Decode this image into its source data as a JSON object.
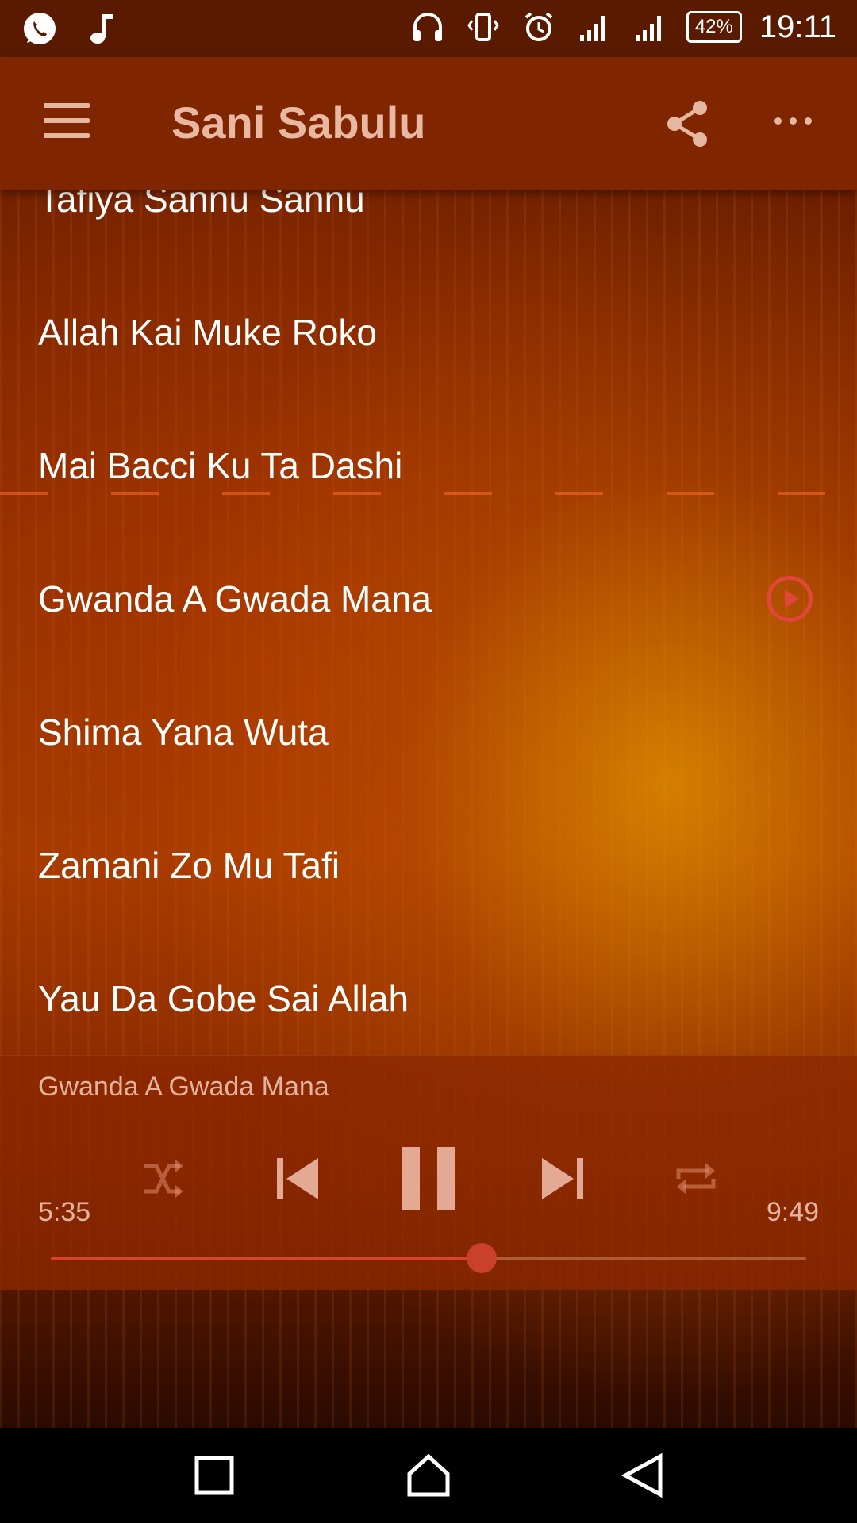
{
  "status_bar": {
    "time": "19:11",
    "battery": "42%",
    "left_icons": [
      "whatsapp-icon",
      "music-note-icon"
    ],
    "right_icons": [
      "headphones-icon",
      "vibrate-icon",
      "alarm-icon",
      "signal-icon",
      "signal-icon"
    ]
  },
  "app_bar": {
    "title": "Sani Sabulu",
    "menu_icon": "hamburger-menu-icon",
    "share_icon": "share-icon",
    "more_icon": "more-options-icon"
  },
  "songs": [
    {
      "title": "Tafiya Sannu Sannu"
    },
    {
      "title": "Allah Kai Muke Roko"
    },
    {
      "title": "Mai Bacci Ku Ta Dashi"
    },
    {
      "title": "Gwanda A Gwada Mana",
      "playing": true
    },
    {
      "title": "Shima Yana Wuta"
    },
    {
      "title": "Zamani Zo Mu Tafi"
    },
    {
      "title": "Yau Da Gobe Sai Allah"
    }
  ],
  "player": {
    "now_playing": "Gwanda A Gwada Mana",
    "current_time": "5:35",
    "total_time": "9:49",
    "progress": 0.57,
    "controls": [
      "shuffle-icon",
      "previous-icon",
      "pause-icon",
      "next-icon",
      "repeat-icon"
    ]
  },
  "nav_bar": {
    "buttons": [
      "recent-apps-icon",
      "home-icon",
      "back-icon"
    ]
  },
  "colors": {
    "app_bar": "#7f2600",
    "status_bar": "#5a1a00",
    "accent": "#e0473a",
    "player_bg": "#8c2800"
  }
}
